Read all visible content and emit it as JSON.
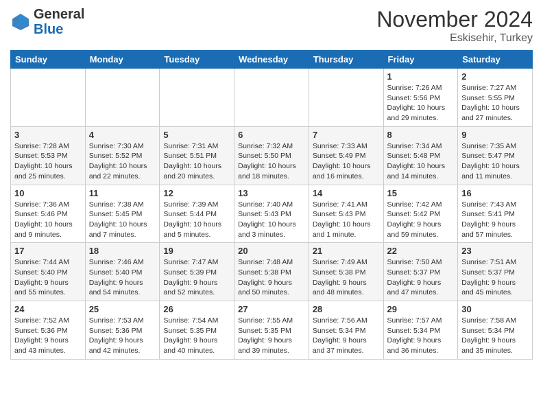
{
  "header": {
    "logo_line1": "General",
    "logo_line2": "Blue",
    "month": "November 2024",
    "location": "Eskisehir, Turkey"
  },
  "weekdays": [
    "Sunday",
    "Monday",
    "Tuesday",
    "Wednesday",
    "Thursday",
    "Friday",
    "Saturday"
  ],
  "weeks": [
    [
      {
        "day": "",
        "info": ""
      },
      {
        "day": "",
        "info": ""
      },
      {
        "day": "",
        "info": ""
      },
      {
        "day": "",
        "info": ""
      },
      {
        "day": "",
        "info": ""
      },
      {
        "day": "1",
        "info": "Sunrise: 7:26 AM\nSunset: 5:56 PM\nDaylight: 10 hours and 29 minutes."
      },
      {
        "day": "2",
        "info": "Sunrise: 7:27 AM\nSunset: 5:55 PM\nDaylight: 10 hours and 27 minutes."
      }
    ],
    [
      {
        "day": "3",
        "info": "Sunrise: 7:28 AM\nSunset: 5:53 PM\nDaylight: 10 hours and 25 minutes."
      },
      {
        "day": "4",
        "info": "Sunrise: 7:30 AM\nSunset: 5:52 PM\nDaylight: 10 hours and 22 minutes."
      },
      {
        "day": "5",
        "info": "Sunrise: 7:31 AM\nSunset: 5:51 PM\nDaylight: 10 hours and 20 minutes."
      },
      {
        "day": "6",
        "info": "Sunrise: 7:32 AM\nSunset: 5:50 PM\nDaylight: 10 hours and 18 minutes."
      },
      {
        "day": "7",
        "info": "Sunrise: 7:33 AM\nSunset: 5:49 PM\nDaylight: 10 hours and 16 minutes."
      },
      {
        "day": "8",
        "info": "Sunrise: 7:34 AM\nSunset: 5:48 PM\nDaylight: 10 hours and 14 minutes."
      },
      {
        "day": "9",
        "info": "Sunrise: 7:35 AM\nSunset: 5:47 PM\nDaylight: 10 hours and 11 minutes."
      }
    ],
    [
      {
        "day": "10",
        "info": "Sunrise: 7:36 AM\nSunset: 5:46 PM\nDaylight: 10 hours and 9 minutes."
      },
      {
        "day": "11",
        "info": "Sunrise: 7:38 AM\nSunset: 5:45 PM\nDaylight: 10 hours and 7 minutes."
      },
      {
        "day": "12",
        "info": "Sunrise: 7:39 AM\nSunset: 5:44 PM\nDaylight: 10 hours and 5 minutes."
      },
      {
        "day": "13",
        "info": "Sunrise: 7:40 AM\nSunset: 5:43 PM\nDaylight: 10 hours and 3 minutes."
      },
      {
        "day": "14",
        "info": "Sunrise: 7:41 AM\nSunset: 5:43 PM\nDaylight: 10 hours and 1 minute."
      },
      {
        "day": "15",
        "info": "Sunrise: 7:42 AM\nSunset: 5:42 PM\nDaylight: 9 hours and 59 minutes."
      },
      {
        "day": "16",
        "info": "Sunrise: 7:43 AM\nSunset: 5:41 PM\nDaylight: 9 hours and 57 minutes."
      }
    ],
    [
      {
        "day": "17",
        "info": "Sunrise: 7:44 AM\nSunset: 5:40 PM\nDaylight: 9 hours and 55 minutes."
      },
      {
        "day": "18",
        "info": "Sunrise: 7:46 AM\nSunset: 5:40 PM\nDaylight: 9 hours and 54 minutes."
      },
      {
        "day": "19",
        "info": "Sunrise: 7:47 AM\nSunset: 5:39 PM\nDaylight: 9 hours and 52 minutes."
      },
      {
        "day": "20",
        "info": "Sunrise: 7:48 AM\nSunset: 5:38 PM\nDaylight: 9 hours and 50 minutes."
      },
      {
        "day": "21",
        "info": "Sunrise: 7:49 AM\nSunset: 5:38 PM\nDaylight: 9 hours and 48 minutes."
      },
      {
        "day": "22",
        "info": "Sunrise: 7:50 AM\nSunset: 5:37 PM\nDaylight: 9 hours and 47 minutes."
      },
      {
        "day": "23",
        "info": "Sunrise: 7:51 AM\nSunset: 5:37 PM\nDaylight: 9 hours and 45 minutes."
      }
    ],
    [
      {
        "day": "24",
        "info": "Sunrise: 7:52 AM\nSunset: 5:36 PM\nDaylight: 9 hours and 43 minutes."
      },
      {
        "day": "25",
        "info": "Sunrise: 7:53 AM\nSunset: 5:36 PM\nDaylight: 9 hours and 42 minutes."
      },
      {
        "day": "26",
        "info": "Sunrise: 7:54 AM\nSunset: 5:35 PM\nDaylight: 9 hours and 40 minutes."
      },
      {
        "day": "27",
        "info": "Sunrise: 7:55 AM\nSunset: 5:35 PM\nDaylight: 9 hours and 39 minutes."
      },
      {
        "day": "28",
        "info": "Sunrise: 7:56 AM\nSunset: 5:34 PM\nDaylight: 9 hours and 37 minutes."
      },
      {
        "day": "29",
        "info": "Sunrise: 7:57 AM\nSunset: 5:34 PM\nDaylight: 9 hours and 36 minutes."
      },
      {
        "day": "30",
        "info": "Sunrise: 7:58 AM\nSunset: 5:34 PM\nDaylight: 9 hours and 35 minutes."
      }
    ]
  ]
}
